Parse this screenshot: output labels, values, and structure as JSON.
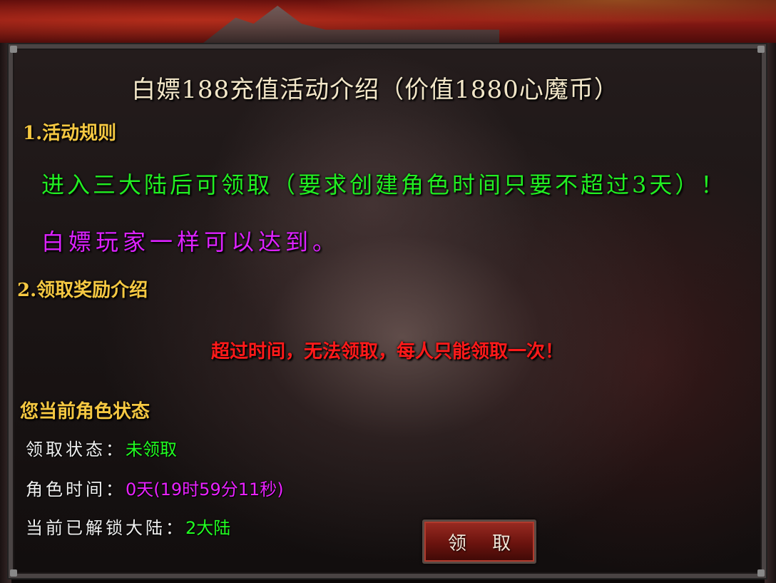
{
  "title": "白嫖188充值活动介绍（价值1880心魔币）",
  "section1": {
    "heading": "1.活动规则"
  },
  "rules": [
    "进入三大陆后可领取（要求创建角色时间只要不超过3天）！",
    "白嫖玩家一样可以达到。"
  ],
  "section2": {
    "heading": "2.领取奖励介绍"
  },
  "warning": "超过时间，无法领取，每人只能领取一次！",
  "status": {
    "heading": "您当前角色状态",
    "claim_label": "领取状态：",
    "claim_value": "未领取",
    "time_label": "角色时间：",
    "time_value": "0天(19时59分11秒)",
    "continent_label": "当前已解锁大陆：",
    "continent_value": "2大陆"
  },
  "claim_button": "领 取",
  "colors": {
    "heading_gold": "#f5c842",
    "rule_green": "#22ee22",
    "rule_purple": "#dd22ff",
    "warning_red": "#ff1a1a",
    "value_green": "#22ff22",
    "value_purple": "#e922ff"
  }
}
